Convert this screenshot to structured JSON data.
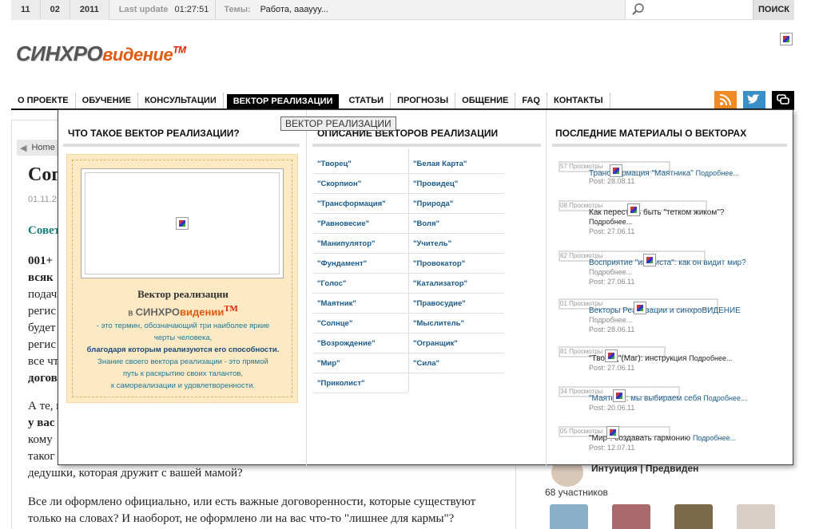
{
  "topbar": {
    "day": "11",
    "month": "02",
    "year": "2011",
    "last_update_label": "Last update",
    "last_update_time": "01:27:51",
    "topics_label": "Темы:",
    "topics_value": "Работа, аааууу...",
    "search_button": "ПОИСК"
  },
  "logo": {
    "part1": "СИНХРО",
    "part2": "видение",
    "tm": "TM"
  },
  "nav": {
    "items": [
      "О ПРОЕКТЕ",
      "ОБУЧЕНИЕ",
      "КОНСУЛЬТАЦИИ",
      "ВЕКТОР РЕАЛИЗАЦИИ",
      "СТАТЬИ",
      "ПРОГНОЗЫ",
      "ОБЩЕНИЕ",
      "FAQ",
      "КОНТАКТЫ"
    ],
    "active": "ВЕКТОР РЕАЛИЗАЦИИ",
    "icons": [
      "rss-icon",
      "twitter-icon",
      "chat-icon"
    ],
    "colors": {
      "rss": "#f08a24",
      "twitter": "#3a8fc8",
      "chat": "#000000"
    }
  },
  "tooltip": "ВЕКТОР РЕАЛИЗАЦИИ",
  "article": {
    "crumb": "Home",
    "title": "Сог",
    "date": "01.11.2",
    "subtitle": "Совет",
    "lines": [
      "001+",
      "всяк",
      "подач",
      "регис",
      "будет",
      "регис",
      "все чт",
      "догов",
      "А те, н",
      "у вас",
      "кому",
      "таког",
      "дедушки, которая дружит с вашей мамой?",
      "Все ли оформлено официально, или есть важные договоренности, которые существуют",
      "только на словах? И наоборот, не оформлено ли на вас что-то \"лишнее для кармы\"?"
    ]
  },
  "sidebar": {
    "group_name": "Интуиция | Предвиден",
    "members": "68 участников"
  },
  "mega": {
    "col1": {
      "heading": "ЧТО ТАКОЕ ВЕКТОР РЕАЛИЗАЦИИ?",
      "box_title": "Вектор реализации",
      "box_in": "в",
      "brand1": "СИНХРО",
      "brand2": "видении",
      "brand_tm": "TM",
      "text1": "- это термин, обозначающий три наиболее яркие",
      "text2": "черты человека,",
      "text3": "благодаря которым реализуются его способности.",
      "text4": "Знание своего вектора реализации - это прямой",
      "text5": "путь к раскрытию своих талантов,",
      "text6": "к самореализации и удовлетворенности."
    },
    "col2": {
      "heading": "ОПИСАНИЕ ВЕКТОРОВ РЕАЛИЗАЦИИ",
      "left": [
        "\"Творец\"",
        "\"Скорпион\"",
        "\"Трансформация\"",
        "\"Равновесие\"",
        "\"Манипулятор\"",
        "\"Фундамент\"",
        "\"Голос\"",
        "\"Маятник\"",
        "\"Солнце\"",
        "\"Возрождение\"",
        "\"Мир\"",
        "\"Приколист\""
      ],
      "right": [
        "\"Белая Карта\"",
        "\"Провидец\"",
        "\"Природа\"",
        "\"Воля\"",
        "\"Учитель\"",
        "\"Провокатор\"",
        "\"Катализатор\"",
        "\"Правосудие\"",
        "\"Мыслитель\"",
        "\"Огранщик\"",
        "\"Сила\""
      ]
    },
    "col3": {
      "heading": "ПОСЛЕДНИЕ МАТЕРИАЛЫ О ВЕКТОРАХ",
      "posts": [
        {
          "views": "57 Просмотры",
          "title": "Трансформация \"Маятника\"",
          "more": "Подробнее...",
          "date": "Post: 28.08.11"
        },
        {
          "views": "08 Просмотры",
          "title": "Как перестать быть \"тетком жиком\"?",
          "more": "Подробнее...",
          "date": "Post: 27.06.11"
        },
        {
          "views": "62 Просмотры",
          "title": "Восприятие \"иколиста\": как он видит мир?",
          "more": "Подробнее...",
          "date": "Post: 27.06.11"
        },
        {
          "views": "01 Просмотры",
          "title": "Векторы Реализации и синхроВИДЕНИЕ",
          "more": "Подробнее...",
          "date": "Post: 28.06.11"
        },
        {
          "views": "81 Просмотры",
          "title": "\"Творец\"(Маг): инструкция",
          "more": "Подробнее...",
          "date": "Post: 27.06.11"
        },
        {
          "views": "34 Просмотры",
          "title": "\"Маятник\": мы выбираем себя",
          "more": "Подробнее...",
          "date": "Post: 20.06.11"
        },
        {
          "views": "05 Просмотры",
          "title": "\"Мир\": создавать гармонию",
          "more": "Подробнее...",
          "date": "Post: 12.07.11"
        }
      ]
    }
  }
}
